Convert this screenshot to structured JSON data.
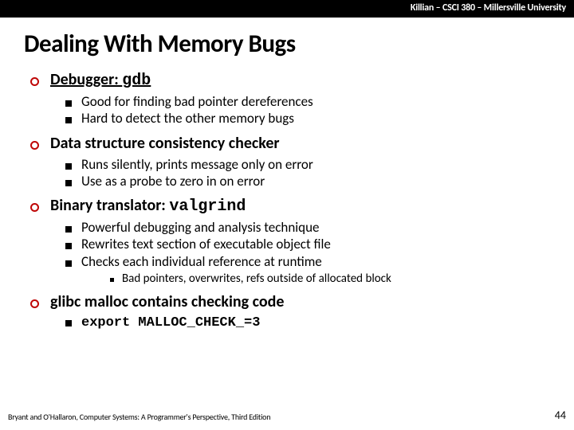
{
  "header": "Killian – CSCI 380 – Millersville University",
  "title": "Dealing With Memory Bugs",
  "items": [
    {
      "label_prefix": "Debugger: ",
      "label_mono": "gdb",
      "underline": true,
      "sub": [
        {
          "text": "Good for finding  bad pointer dereferences"
        },
        {
          "text": "Hard to detect the other memory bugs"
        }
      ]
    },
    {
      "label_prefix": "Data structure consistency checker",
      "label_mono": "",
      "underline": false,
      "sub": [
        {
          "text": " Runs silently, prints message only on error"
        },
        {
          "text": "Use as a probe to zero in on error"
        }
      ]
    },
    {
      "label_prefix": "Binary translator: ",
      "label_mono": "valgrind",
      "underline": false,
      "sub": [
        {
          "text": "Powerful debugging and analysis technique"
        },
        {
          "text": "Rewrites text section of executable object file"
        },
        {
          "text": "Checks each individual reference at runtime",
          "subsub": [
            "Bad pointers, overwrites, refs outside of allocated block"
          ]
        }
      ]
    },
    {
      "label_prefix": "glibc malloc contains checking code",
      "label_mono": "",
      "underline": false,
      "sub": [
        {
          "mono": "export MALLOC_CHECK_=3"
        }
      ]
    }
  ],
  "footer_left": "Bryant and O'Hallaron, Computer Systems: A Programmer's Perspective, Third Edition",
  "footer_right": "44"
}
